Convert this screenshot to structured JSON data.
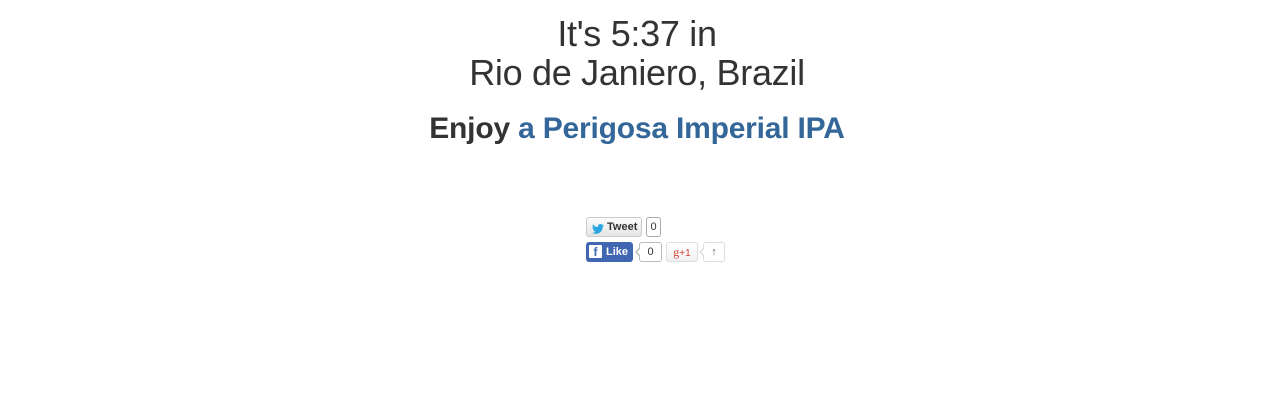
{
  "headline": {
    "line1": "It's 5:37 in",
    "line2": "Rio de Janiero, Brazil"
  },
  "enjoy": {
    "prefix": "Enjoy",
    "beer_link": "a Perigosa Imperial IPA",
    "link_color": "#336699"
  },
  "social": {
    "tweet": {
      "label": "Tweet",
      "count": "0",
      "icon": "twitter-bird-icon"
    },
    "facebook": {
      "label": "Like",
      "count": "0",
      "icon": "facebook-f-icon",
      "color": "#4267b2"
    },
    "gplus": {
      "label_g": "g",
      "label_plus": "+1",
      "count": "↑",
      "color": "#d73d32"
    }
  }
}
